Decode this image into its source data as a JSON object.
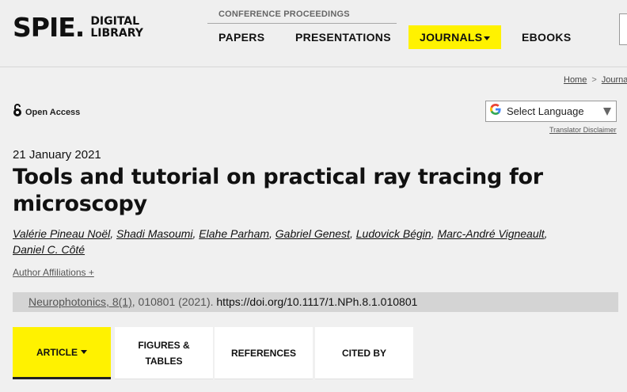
{
  "header": {
    "logo_main": "SPIE.",
    "logo_sub_1": "DIGITAL",
    "logo_sub_2": "LIBRARY",
    "conference_label": "CONFERENCE PROCEEDINGS",
    "nav": {
      "papers": "PAPERS",
      "presentations": "PRESENTATIONS",
      "journals": "JOURNALS",
      "ebooks": "EBOOKS"
    },
    "accent_color": "#fff200"
  },
  "breadcrumb": {
    "home": "Home",
    "separator": ">",
    "next": "Journals"
  },
  "open_access": {
    "label": "Open Access",
    "icon": "open-access-lock-icon"
  },
  "language": {
    "select_label": "Select Language",
    "disclaimer": "Translator Disclaimer",
    "icon": "google-g-icon"
  },
  "article": {
    "date": "21 January 2021",
    "title": "Tools and tutorial on practical ray tracing for microscopy",
    "authors": [
      "Valérie Pineau Noël",
      "Shadi Masoumi",
      "Elahe Parham",
      "Gabriel Genest",
      "Ludovick Bégin",
      "Marc-André Vigneault",
      "Daniel C. Côté"
    ],
    "affiliations_label": "Author Affiliations +"
  },
  "citation": {
    "journal": "Neurophotonics, 8(1)",
    "rest": ", 010801 (2021). ",
    "doi": "https://doi.org/10.1117/1.NPh.8.1.010801"
  },
  "tabs": {
    "article": "ARTICLE",
    "figures_line1": "FIGURES &",
    "figures_line2": "TABLES",
    "references": "REFERENCES",
    "cited_by": "CITED BY"
  }
}
